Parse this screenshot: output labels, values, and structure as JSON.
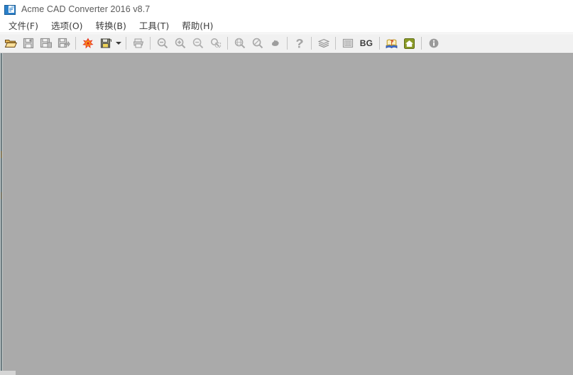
{
  "window": {
    "title": "Acme CAD Converter 2016 v8.7",
    "app_icon": "cad-document-icon",
    "background_color": "#aaaaaa",
    "titlebar_color": "#ffffff",
    "toolbar_color": "#f1f1f1"
  },
  "menubar": {
    "items": [
      {
        "label": "文件(F)",
        "name": "menu-file"
      },
      {
        "label": "选项(O)",
        "name": "menu-options"
      },
      {
        "label": "转换(B)",
        "name": "menu-convert"
      },
      {
        "label": "工具(T)",
        "name": "menu-tools"
      },
      {
        "label": "帮助(H)",
        "name": "menu-help"
      }
    ]
  },
  "toolbar": {
    "buttons": [
      {
        "name": "open-file-icon",
        "tip": "Open",
        "enabled": true
      },
      {
        "name": "save-icon",
        "tip": "Save",
        "enabled": false
      },
      {
        "name": "save-as-icon",
        "tip": "Save As",
        "enabled": false
      },
      {
        "name": "export-icon",
        "tip": "Export",
        "enabled": false
      },
      {
        "name": "pdf-export-icon",
        "tip": "Export to PDF",
        "enabled": true
      },
      {
        "name": "batch-convert-icon",
        "tip": "Batch Convert",
        "enabled": true
      },
      {
        "name": "batch-convert-dropdown-arrow-icon",
        "tip": "More",
        "enabled": true
      },
      {
        "name": "print-icon",
        "tip": "Print",
        "enabled": false
      },
      {
        "name": "zoom-out-icon",
        "tip": "Zoom Out",
        "enabled": false
      },
      {
        "name": "zoom-in-icon",
        "tip": "Zoom In",
        "enabled": false
      },
      {
        "name": "zoom-previous-icon",
        "tip": "Zoom Previous",
        "enabled": false
      },
      {
        "name": "zoom-window-icon",
        "tip": "Zoom Window",
        "enabled": false
      },
      {
        "name": "zoom-extents-icon",
        "tip": "Zoom Extents",
        "enabled": false
      },
      {
        "name": "zoom-all-icon",
        "tip": "Zoom All",
        "enabled": false
      },
      {
        "name": "pan-icon",
        "tip": "Pan",
        "enabled": false
      },
      {
        "name": "measure-icon",
        "tip": "Measure",
        "enabled": false
      },
      {
        "name": "layers-icon",
        "tip": "Layers",
        "enabled": false
      },
      {
        "name": "image-icon",
        "tip": "Image",
        "enabled": false
      },
      {
        "name": "background-color-button",
        "tip": "Background",
        "enabled": true,
        "label": "BG"
      },
      {
        "name": "help-book-icon",
        "tip": "Help",
        "enabled": true
      },
      {
        "name": "home-icon",
        "tip": "Home Page",
        "enabled": true
      },
      {
        "name": "about-info-icon",
        "tip": "About",
        "enabled": true
      }
    ],
    "bg_label": "BG"
  },
  "canvas": {
    "content": "",
    "empty": true
  }
}
